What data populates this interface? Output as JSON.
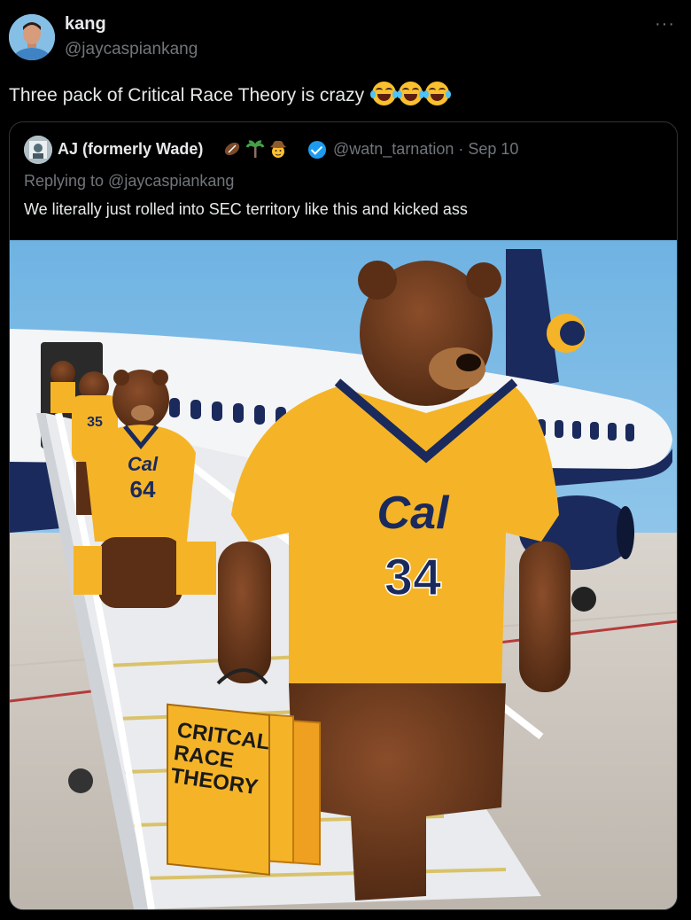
{
  "tweet": {
    "author_name": "kang",
    "author_handle": "@jaycaspiankang",
    "more_label": "···",
    "text": "Three pack of Critical Race Theory is crazy",
    "emoji": "face-with-tears-of-joy",
    "emoji_count": 3
  },
  "quoted": {
    "author_name": "AJ (formerly Wade)",
    "author_badges": [
      "football-emoji",
      "palm-tree-emoji",
      "cowboy-emoji"
    ],
    "verified": true,
    "handle_and_date": "@watn_tarnation · Sep 10",
    "replying_to": "Replying to @jaycaspiankang",
    "text": "We literally just rolled into SEC territory like this and kicked ass",
    "image": {
      "subject": "bears in football jerseys carrying books down airplane stairs",
      "jersey_wordmark": "Cal",
      "jersey_numbers": [
        "34",
        "64",
        "35"
      ],
      "book_title_lines": [
        "CRITCAL",
        "RACE",
        "THEORY"
      ],
      "colors": {
        "sky": "#8cc6ea",
        "jersey": "#f5b427",
        "navy": "#1b2a5c",
        "bear": "#6b3a1f"
      }
    }
  }
}
